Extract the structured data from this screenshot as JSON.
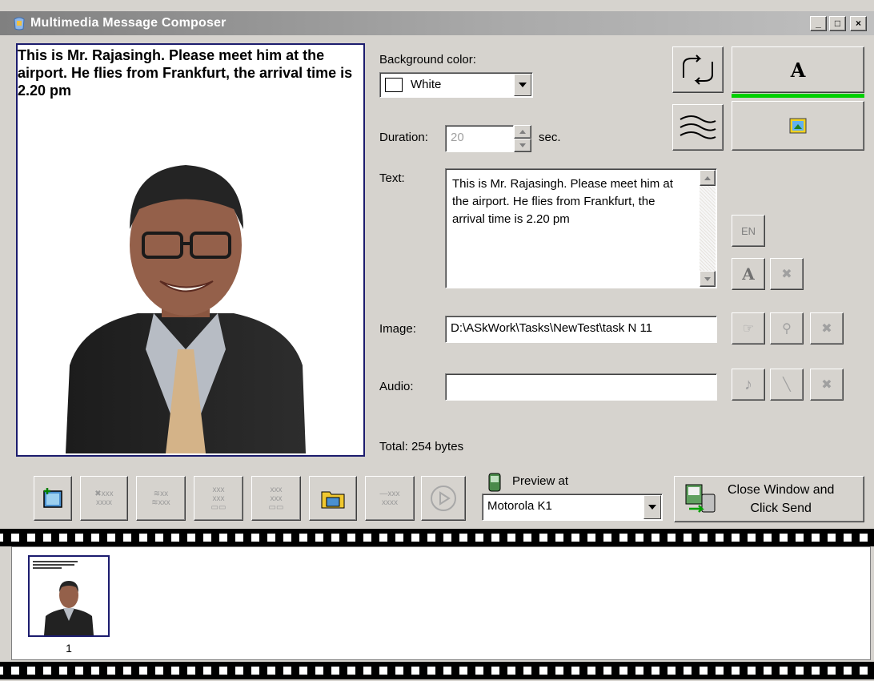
{
  "window": {
    "title": "Multimedia Message Composer",
    "minimize_label": "_",
    "maximize_label": "□",
    "close_label": "×"
  },
  "preview": {
    "text": "This is Mr. Rajasingh. Please meet him at the airport. He flies from Frankfurt, the arrival time is 2.20 pm"
  },
  "properties": {
    "background_color_label": "Background color:",
    "background_color_value": "White",
    "duration_label": "Duration:",
    "duration_value": "20",
    "duration_unit": "sec.",
    "text_label": "Text:",
    "text_value": "This is Mr. Rajasingh. Please meet him at the airport. He flies from Frankfurt, the arrival time is 2.20 pm",
    "image_label": "Image:",
    "image_value": "D:\\ASkWork\\Tasks\\NewTest\\task N 11",
    "audio_label": "Audio:",
    "audio_value": "",
    "total_label": "Total: 254 bytes",
    "language_button": "EN",
    "text_mode_button": "A"
  },
  "toolbar": {
    "preview_at_label": "Preview at",
    "preview_device": "Motorola K1",
    "send_label_line1": "Close Window and",
    "send_label_line2": "Click Send"
  },
  "slides": [
    {
      "number": "1"
    }
  ],
  "colors": {
    "accent_green": "#00d000",
    "canvas_border": "#1c1c6e",
    "face": "#d6d3ce"
  }
}
